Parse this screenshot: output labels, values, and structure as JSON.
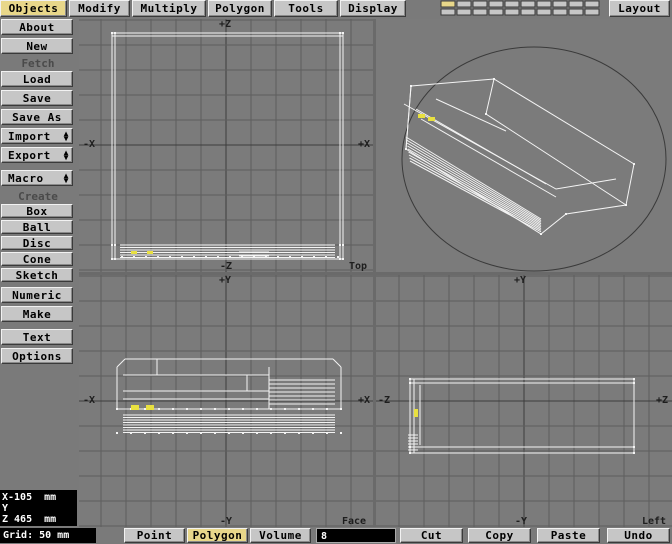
{
  "top_tabs": [
    "Objects",
    "Modify",
    "Multiply",
    "Polygon",
    "Tools",
    "Display"
  ],
  "layout_label": "Layout",
  "sidebar": {
    "about": "About",
    "new": "New",
    "fetch_header": "Fetch",
    "load": "Load",
    "save": "Save",
    "save_as": "Save As",
    "import": "Import",
    "export": "Export",
    "macro": "Macro",
    "create_header": "Create",
    "box": "Box",
    "ball": "Ball",
    "disc": "Disc",
    "cone": "Cone",
    "sketch": "Sketch",
    "numeric": "Numeric",
    "make": "Make",
    "text": "Text",
    "options": "Options"
  },
  "viewports": {
    "top": {
      "name": "Top",
      "up": "+Z",
      "down": "-Z",
      "left": "-X",
      "right": "+X"
    },
    "face": {
      "name": "Face",
      "up": "+Y",
      "down": "-Y",
      "left": "-X",
      "right": "+X"
    },
    "left": {
      "name": "Left",
      "up": "+Y",
      "down": "-Y",
      "left": "-Z",
      "right": "+Z"
    }
  },
  "coords": {
    "x": "X-105  mm",
    "y": "Y",
    "z": "Z 465  mm"
  },
  "grid_readout": "Grid: 50 mm",
  "modes": [
    "Point",
    "Polygon",
    "Volume"
  ],
  "active_mode": "Polygon",
  "numeric_field": "8",
  "edit": {
    "cut": "Cut",
    "copy": "Copy",
    "paste": "Paste",
    "undo": "Undo"
  },
  "colors": {
    "selection": "#e8d78a",
    "wire": "#ffffff",
    "highlight": "#e8e040"
  }
}
